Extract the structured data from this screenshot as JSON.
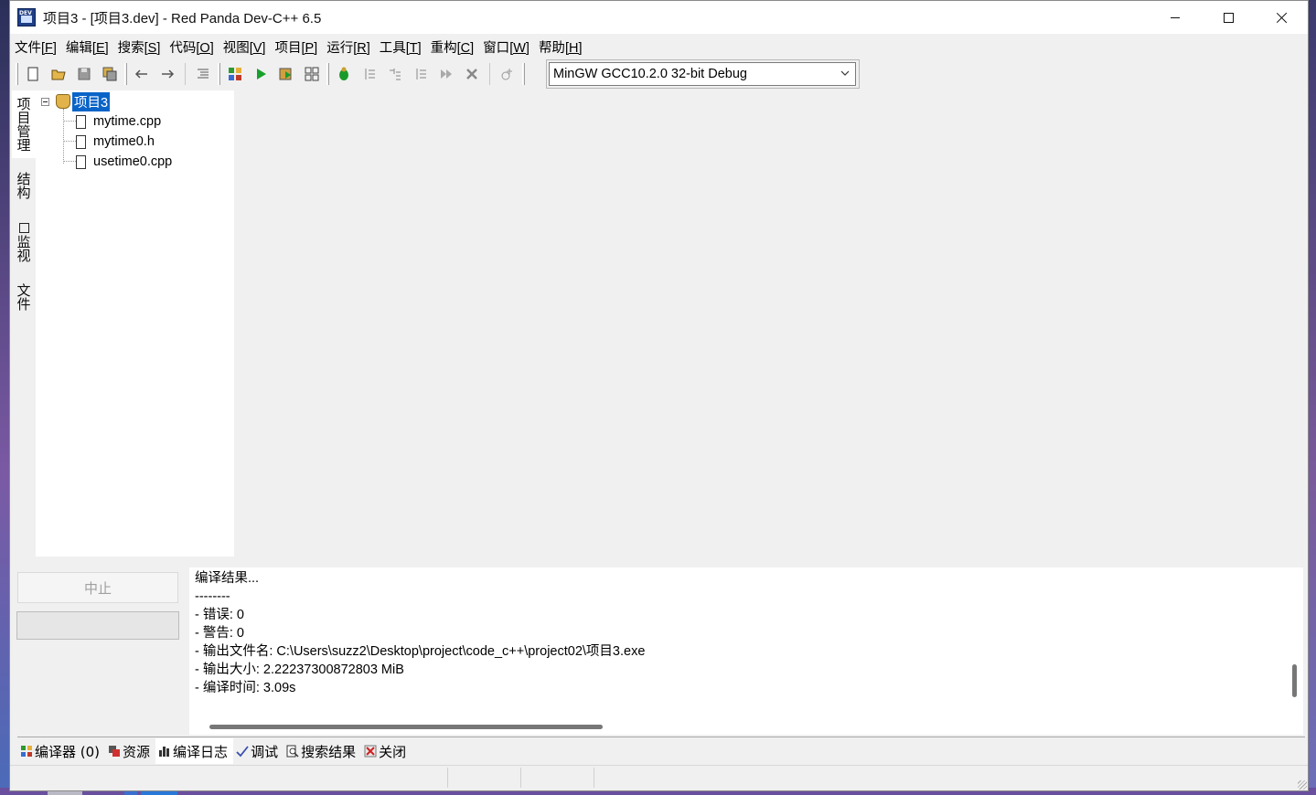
{
  "window": {
    "title": "项目3 - [项目3.dev] - Red Panda Dev-C++ 6.5"
  },
  "menu": [
    {
      "label": "文件",
      "key": "[F]"
    },
    {
      "label": "编辑",
      "key": "[E]"
    },
    {
      "label": "搜索",
      "key": "[S]"
    },
    {
      "label": "代码",
      "key": "[O]"
    },
    {
      "label": "视图",
      "key": "[V]"
    },
    {
      "label": "项目",
      "key": "[P]"
    },
    {
      "label": "运行",
      "key": "[R]"
    },
    {
      "label": "工具",
      "key": "[T]"
    },
    {
      "label": "重构",
      "key": "[C]"
    },
    {
      "label": "窗口",
      "key": "[W]"
    },
    {
      "label": "帮助",
      "key": "[H]"
    }
  ],
  "toolbar": {
    "compiler_selected": "MinGW GCC10.2.0 32-bit Debug"
  },
  "side_tabs": [
    "项目管理",
    "结构",
    "监视",
    "文件"
  ],
  "project_tree": {
    "root": "项目3",
    "files": [
      "mytime.cpp",
      "mytime0.h",
      "usetime0.cpp"
    ]
  },
  "bottom": {
    "stop_label": "中止",
    "output_lines": [
      "编译结果...",
      "--------",
      "- 错误: 0",
      "- 警告: 0",
      "- 输出文件名: C:\\Users\\suzz2\\Desktop\\project\\code_c++\\project02\\项目3.exe",
      "- 输出大小: 2.22237300872803 MiB",
      "- 编译时间: 3.09s"
    ],
    "tabs": [
      "编译器 (0)",
      "资源",
      "编译日志",
      "调试",
      "搜索结果",
      "关闭"
    ]
  },
  "colors": {
    "selection": "#0a64c8",
    "accent_green": "#1a9a2a"
  }
}
